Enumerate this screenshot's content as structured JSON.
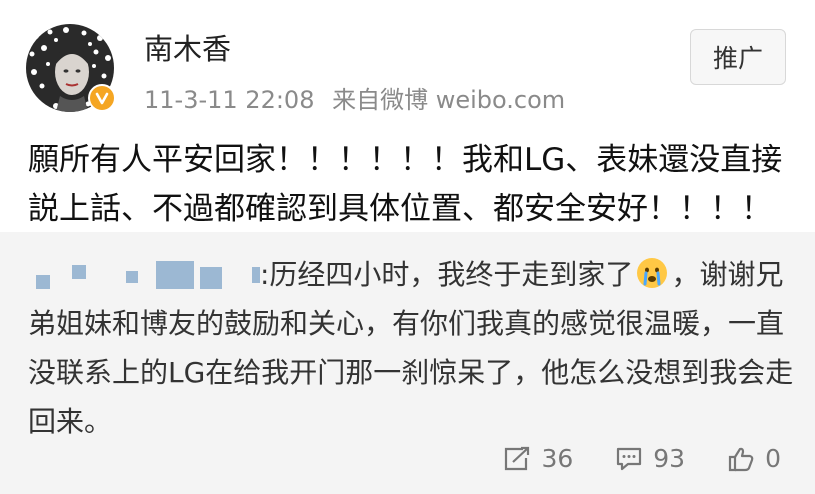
{
  "post": {
    "username": "南木香",
    "timestamp": "11-3-11 22:08",
    "source": "来自微博 weibo.com",
    "promote_label": "推广",
    "text": "願所有人平安回家！！！！！！我和LG、表妹還没直接説上話、不過都確認到具体位置、都安全安好！！！！",
    "avatar_icon": "avatar-portrait",
    "verified_icon": "verified-badge-icon",
    "verified_color": "#f5a623"
  },
  "repost": {
    "text_before_emoji": ":历经四小时，我终于走到家了",
    "emoji": "crying-face-emoji",
    "text_after_emoji": "，谢谢兄弟姐妹和博友的鼓励和关心，有你们我真的感觉很温暖，一直没联系上的LG在给我开门那一刹惊呆了，他怎么没想到我会走回来。",
    "redaction_color": "#9cb8d3",
    "background": "#f4f4f4"
  },
  "actions": {
    "repost_count": "36",
    "comment_count": "93",
    "like_count": "0"
  }
}
